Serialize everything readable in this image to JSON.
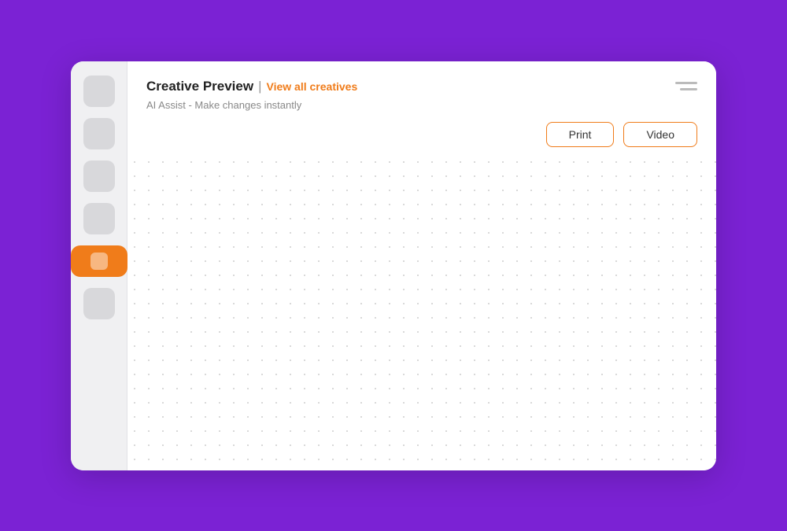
{
  "background": {
    "color": "#7b22d4"
  },
  "window": {
    "title": "Creative Preview",
    "separator": "|",
    "view_all_label": "View all creatives",
    "subtitle": "AI Assist - Make changes instantly"
  },
  "header": {
    "menu_icon_label": "menu"
  },
  "buttons": [
    {
      "id": "print-btn",
      "label": "Print"
    },
    {
      "id": "video-btn",
      "label": "Video"
    }
  ],
  "sidebar": {
    "items": [
      {
        "id": "item-1",
        "active": false
      },
      {
        "id": "item-2",
        "active": false
      },
      {
        "id": "item-3",
        "active": false
      },
      {
        "id": "item-4",
        "active": false
      },
      {
        "id": "item-5",
        "active": true
      },
      {
        "id": "item-6",
        "active": false
      }
    ]
  },
  "colors": {
    "accent": "#f07c1a",
    "purple": "#7b22d4",
    "inactive_item": "#d8d8db"
  }
}
